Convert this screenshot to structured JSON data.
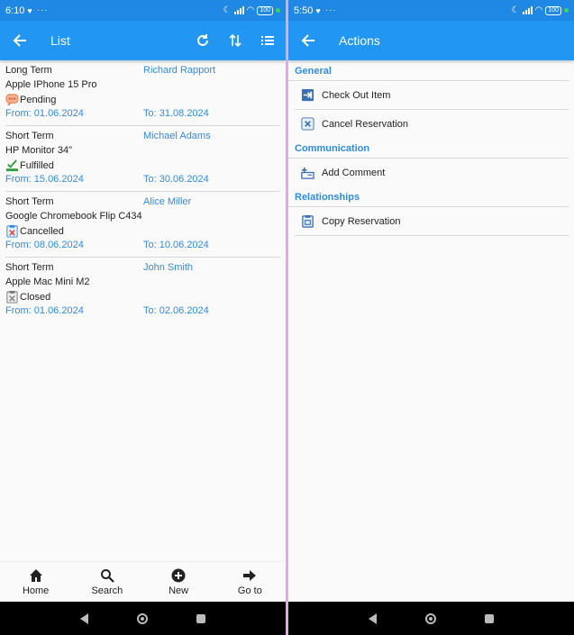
{
  "left": {
    "status": {
      "time": "6:10",
      "dots": "···",
      "battery": "100"
    },
    "appbar": {
      "title": "List"
    },
    "items": [
      {
        "type": "Long Term",
        "contact": "Richard Rapport",
        "device": "Apple IPhone 15 Pro",
        "status": "Pending",
        "status_icon": "pending-chat-icon",
        "from": "From: 01.06.2024",
        "to": "To: 31.08.2024"
      },
      {
        "type": "Short Term",
        "contact": "Michael Adams",
        "device": "HP Monitor 34\"",
        "status": "Fulfilled",
        "status_icon": "fulfilled-check-icon",
        "from": "From: 15.06.2024",
        "to": "To: 30.06.2024"
      },
      {
        "type": "Short Term",
        "contact": "Alice Miller",
        "device": "Google Chromebook Flip C434",
        "status": "Cancelled",
        "status_icon": "cancelled-clipboard-icon",
        "from": "From: 08.06.2024",
        "to": "To: 10.06.2024"
      },
      {
        "type": "Short Term",
        "contact": "John Smith",
        "device": "Apple Mac Mini M2",
        "status": "Closed",
        "status_icon": "closed-clipboard-icon",
        "from": "From: 01.06.2024",
        "to": "To: 02.06.2024"
      }
    ],
    "bottom_nav": [
      {
        "label": "Home",
        "icon": "home-icon"
      },
      {
        "label": "Search",
        "icon": "search-icon"
      },
      {
        "label": "New",
        "icon": "add-circle-icon"
      },
      {
        "label": "Go to",
        "icon": "arrow-right-icon"
      }
    ]
  },
  "right": {
    "status": {
      "time": "5:50",
      "dots": "···",
      "battery": "100"
    },
    "appbar": {
      "title": "Actions"
    },
    "sections": [
      {
        "title": "General",
        "actions": [
          {
            "label": "Check Out Item",
            "icon": "check-out-icon"
          },
          {
            "label": "Cancel Reservation",
            "icon": "cancel-reservation-icon"
          }
        ]
      },
      {
        "title": "Communication",
        "actions": [
          {
            "label": "Add Comment",
            "icon": "add-comment-icon"
          }
        ]
      },
      {
        "title": "Relationships",
        "actions": [
          {
            "label": "Copy Reservation",
            "icon": "copy-reservation-icon"
          }
        ]
      }
    ]
  },
  "colors": {
    "primary": "#2196f3",
    "status_bar": "#1f88e4",
    "link_blue": "#2e8be6"
  }
}
